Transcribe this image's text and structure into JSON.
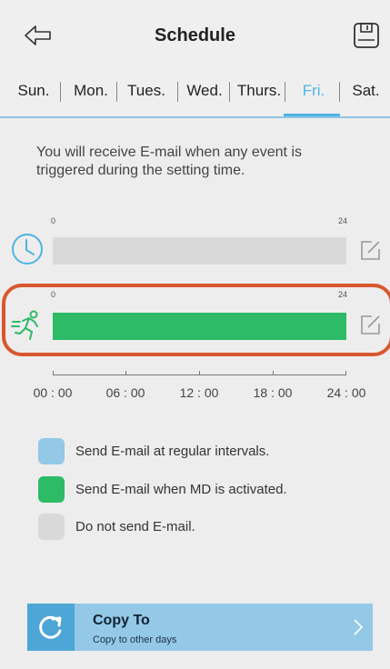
{
  "header": {
    "title": "Schedule",
    "back_icon": "back-arrow-icon",
    "save_icon": "floppy-disk-icon"
  },
  "tabs": [
    {
      "label": "Sun."
    },
    {
      "label": "Mon."
    },
    {
      "label": "Tues."
    },
    {
      "label": "Wed."
    },
    {
      "label": "Thurs."
    },
    {
      "label": "Fri.",
      "active": true
    },
    {
      "label": "Sat."
    }
  ],
  "info_text": "You will receive E-mail when any event is triggered during the setting time.",
  "rows": [
    {
      "icon": "clock-icon",
      "scale_start": "0",
      "scale_end": "24",
      "color": "#d9d9d9",
      "edit_icon": "edit-icon"
    },
    {
      "icon": "running-person-icon",
      "scale_start": "0",
      "scale_end": "24",
      "color": "#2dbb68",
      "edit_icon": "edit-icon"
    }
  ],
  "axis_labels": [
    "00 : 00",
    "06 : 00",
    "12 : 00",
    "18 : 00",
    "24 : 00"
  ],
  "legend": [
    {
      "color": "#93c9e6",
      "label": "Send E-mail at regular intervals."
    },
    {
      "color": "#2dbb68",
      "label": "Send E-mail when MD is activated."
    },
    {
      "color": "#d9d9d9",
      "label": "Do not send E-mail."
    }
  ],
  "copy": {
    "title": "Copy To",
    "subtitle": "Copy to other days",
    "icon": "refresh-icon",
    "chevron_icon": "chevron-right-icon"
  },
  "colors": {
    "accent": "#4fb3e6",
    "highlight": "#d9562e"
  }
}
